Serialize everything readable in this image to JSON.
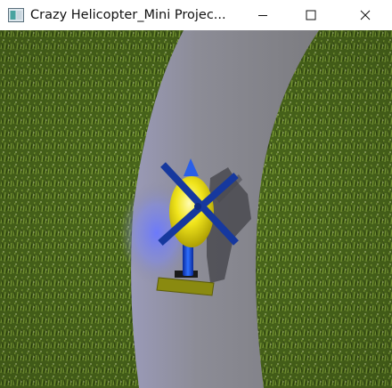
{
  "window": {
    "title": "Crazy Helicopter_Mini Projec..."
  },
  "controls": {
    "minimize": "minimize-icon",
    "maximize": "maximize-icon",
    "close": "close-icon"
  },
  "scene": {
    "background": "grass",
    "road_color": "#8a8a95",
    "helicopter": {
      "body_color": "#f2ea1a",
      "rotor_color": "#1a3fb0",
      "tail_color": "#1f5fe0",
      "skid_color": "#8a8a10"
    }
  }
}
